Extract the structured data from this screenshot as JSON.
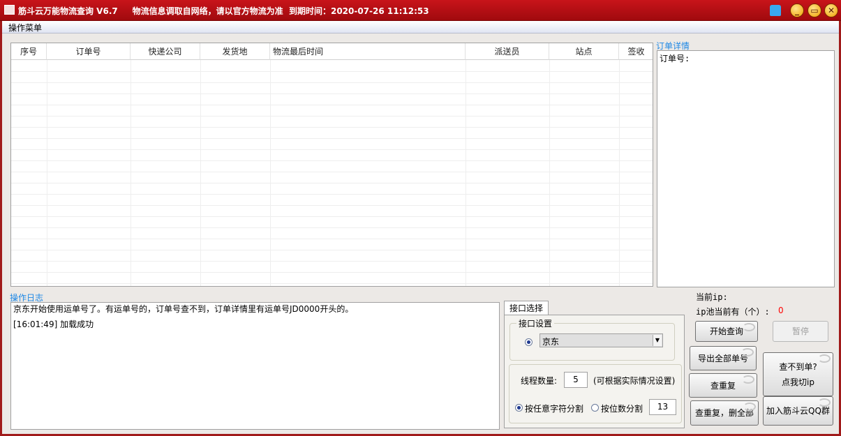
{
  "window": {
    "title": "筋斗云万能物流查询 V6.7     物流信息调取自网络，请以官方物流为准  到期时间：2020-07-26 11:12:53",
    "minimize": "_",
    "maximize": "▭",
    "close": "✕"
  },
  "menu": {
    "items": [
      {
        "label": "操作菜单"
      }
    ]
  },
  "table": {
    "columns": [
      "序号",
      "订单号",
      "快递公司",
      "发货地",
      "物流最后时间",
      "派送员",
      "站点",
      "签收"
    ],
    "rows": []
  },
  "detail": {
    "label": "订单详情",
    "content": "订单号:"
  },
  "log": {
    "label": "操作日志",
    "lines": [
      "京东开始使用运单号了。有运单号的，订单号查不到，订单详情里有运单号JD0000开头的。",
      "[16:01:49] 加载成功"
    ]
  },
  "interface": {
    "tab": "接口选择",
    "group": "接口设置",
    "selected": "京东",
    "threads_label": "线程数量:",
    "threads": "5",
    "threads_hint": "(可根据实际情况设置)",
    "split_any": "按任意字符分割",
    "split_digits": "按位数分割",
    "digits": "13"
  },
  "ip": {
    "current_label": "当前ip:",
    "pool_label": "ip池当前有（个）:",
    "pool_count": "0",
    "pool_color": "#ff0000"
  },
  "buttons": {
    "start": "开始查询",
    "pause": "暂停",
    "export": "导出全部单号",
    "dedupe": "查重复",
    "dedupe_delete": "查重复，删全部",
    "switch_ip_1": "查不到单?",
    "switch_ip_2": "点我切ip",
    "join_qq": "加入筋斗云QQ群"
  }
}
